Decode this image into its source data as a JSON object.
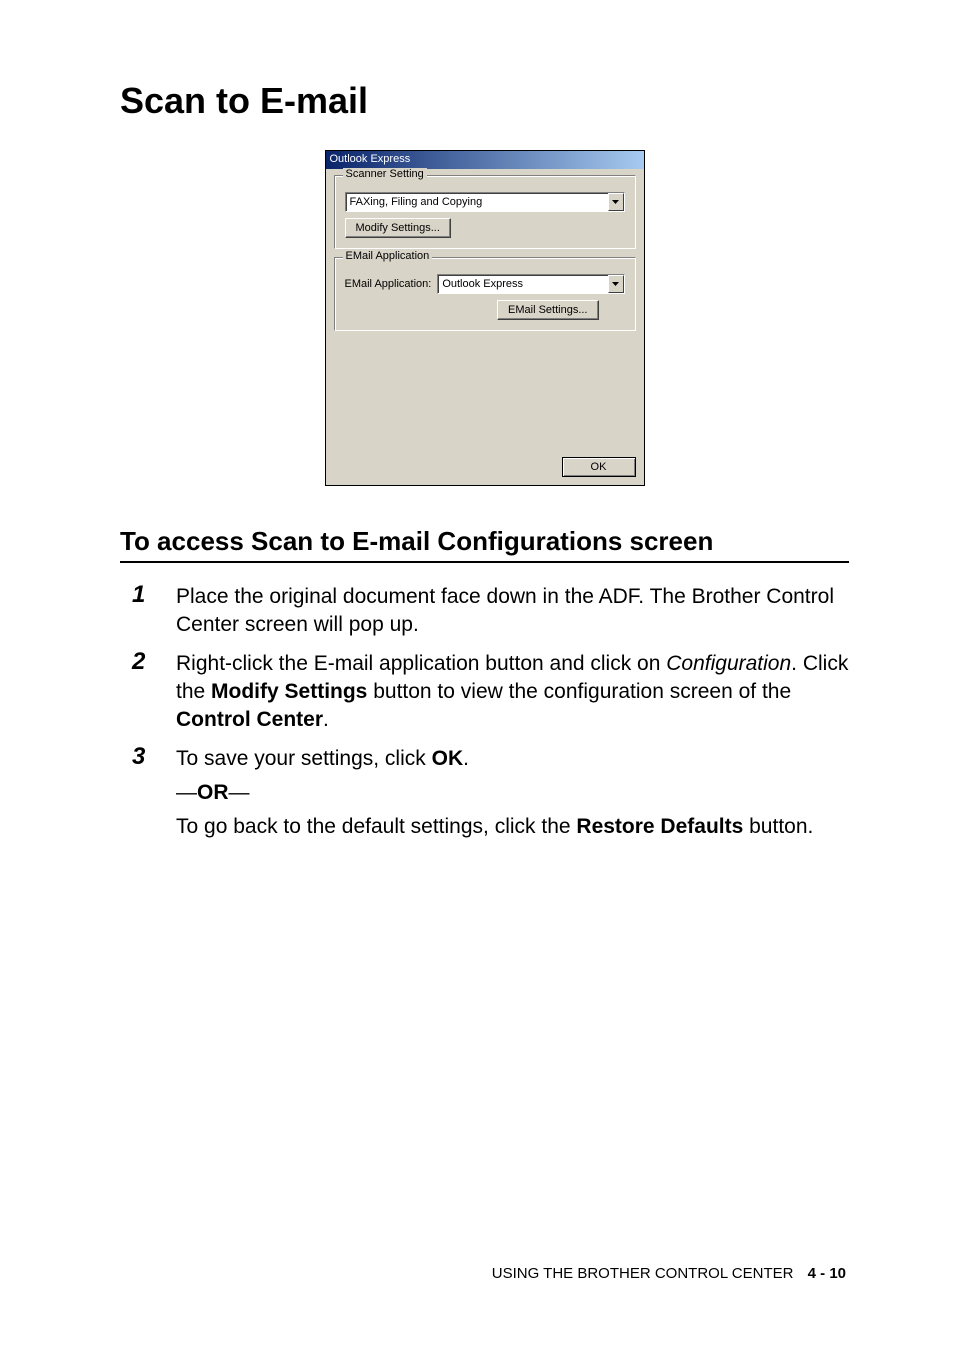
{
  "title": "Scan to E-mail",
  "dialog": {
    "titlebar": "Outlook Express",
    "scanner_group": {
      "legend": "Scanner Setting",
      "preset": "FAXing, Filing and Copying",
      "modify_btn": "Modify Settings..."
    },
    "email_group": {
      "legend": "EMail Application",
      "label": "EMail Application:",
      "value": "Outlook Express",
      "settings_btn": "EMail Settings..."
    },
    "ok_btn": "OK"
  },
  "subheading": "To access Scan to E-mail Configurations screen",
  "steps": {
    "s1": {
      "num": "1",
      "text": "Place the original document face down in the ADF. The Brother Control Center screen will pop up."
    },
    "s2": {
      "num": "2",
      "pre": "Right-click the E-mail application button and click on ",
      "config": "Configuration",
      "mid": ". Click the ",
      "modify": "Modify Settings",
      "mid2": " button to view the configuration screen of the ",
      "cc": "Control Center",
      "post": "."
    },
    "s3": {
      "num": "3",
      "line1_pre": "To save your settings, click ",
      "line1_ok": "OK",
      "line1_post": ".",
      "or_dash": "—",
      "or": "OR",
      "line2_pre": "To go back to the default settings, click the ",
      "restore": "Restore Defaults",
      "line2_post": " button."
    }
  },
  "footer": {
    "text": "USING THE BROTHER CONTROL CENTER",
    "page": "4 - 10"
  }
}
